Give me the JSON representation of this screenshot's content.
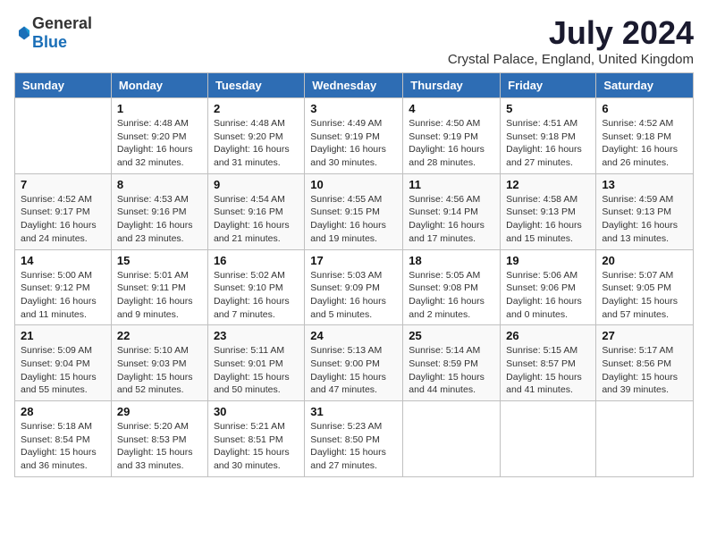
{
  "header": {
    "logo_general": "General",
    "logo_blue": "Blue",
    "month_year": "July 2024",
    "location": "Crystal Palace, England, United Kingdom"
  },
  "weekdays": [
    "Sunday",
    "Monday",
    "Tuesday",
    "Wednesday",
    "Thursday",
    "Friday",
    "Saturday"
  ],
  "weeks": [
    [
      {
        "day": "",
        "info": ""
      },
      {
        "day": "1",
        "info": "Sunrise: 4:48 AM\nSunset: 9:20 PM\nDaylight: 16 hours\nand 32 minutes."
      },
      {
        "day": "2",
        "info": "Sunrise: 4:48 AM\nSunset: 9:20 PM\nDaylight: 16 hours\nand 31 minutes."
      },
      {
        "day": "3",
        "info": "Sunrise: 4:49 AM\nSunset: 9:19 PM\nDaylight: 16 hours\nand 30 minutes."
      },
      {
        "day": "4",
        "info": "Sunrise: 4:50 AM\nSunset: 9:19 PM\nDaylight: 16 hours\nand 28 minutes."
      },
      {
        "day": "5",
        "info": "Sunrise: 4:51 AM\nSunset: 9:18 PM\nDaylight: 16 hours\nand 27 minutes."
      },
      {
        "day": "6",
        "info": "Sunrise: 4:52 AM\nSunset: 9:18 PM\nDaylight: 16 hours\nand 26 minutes."
      }
    ],
    [
      {
        "day": "7",
        "info": "Sunrise: 4:52 AM\nSunset: 9:17 PM\nDaylight: 16 hours\nand 24 minutes."
      },
      {
        "day": "8",
        "info": "Sunrise: 4:53 AM\nSunset: 9:16 PM\nDaylight: 16 hours\nand 23 minutes."
      },
      {
        "day": "9",
        "info": "Sunrise: 4:54 AM\nSunset: 9:16 PM\nDaylight: 16 hours\nand 21 minutes."
      },
      {
        "day": "10",
        "info": "Sunrise: 4:55 AM\nSunset: 9:15 PM\nDaylight: 16 hours\nand 19 minutes."
      },
      {
        "day": "11",
        "info": "Sunrise: 4:56 AM\nSunset: 9:14 PM\nDaylight: 16 hours\nand 17 minutes."
      },
      {
        "day": "12",
        "info": "Sunrise: 4:58 AM\nSunset: 9:13 PM\nDaylight: 16 hours\nand 15 minutes."
      },
      {
        "day": "13",
        "info": "Sunrise: 4:59 AM\nSunset: 9:13 PM\nDaylight: 16 hours\nand 13 minutes."
      }
    ],
    [
      {
        "day": "14",
        "info": "Sunrise: 5:00 AM\nSunset: 9:12 PM\nDaylight: 16 hours\nand 11 minutes."
      },
      {
        "day": "15",
        "info": "Sunrise: 5:01 AM\nSunset: 9:11 PM\nDaylight: 16 hours\nand 9 minutes."
      },
      {
        "day": "16",
        "info": "Sunrise: 5:02 AM\nSunset: 9:10 PM\nDaylight: 16 hours\nand 7 minutes."
      },
      {
        "day": "17",
        "info": "Sunrise: 5:03 AM\nSunset: 9:09 PM\nDaylight: 16 hours\nand 5 minutes."
      },
      {
        "day": "18",
        "info": "Sunrise: 5:05 AM\nSunset: 9:08 PM\nDaylight: 16 hours\nand 2 minutes."
      },
      {
        "day": "19",
        "info": "Sunrise: 5:06 AM\nSunset: 9:06 PM\nDaylight: 16 hours\nand 0 minutes."
      },
      {
        "day": "20",
        "info": "Sunrise: 5:07 AM\nSunset: 9:05 PM\nDaylight: 15 hours\nand 57 minutes."
      }
    ],
    [
      {
        "day": "21",
        "info": "Sunrise: 5:09 AM\nSunset: 9:04 PM\nDaylight: 15 hours\nand 55 minutes."
      },
      {
        "day": "22",
        "info": "Sunrise: 5:10 AM\nSunset: 9:03 PM\nDaylight: 15 hours\nand 52 minutes."
      },
      {
        "day": "23",
        "info": "Sunrise: 5:11 AM\nSunset: 9:01 PM\nDaylight: 15 hours\nand 50 minutes."
      },
      {
        "day": "24",
        "info": "Sunrise: 5:13 AM\nSunset: 9:00 PM\nDaylight: 15 hours\nand 47 minutes."
      },
      {
        "day": "25",
        "info": "Sunrise: 5:14 AM\nSunset: 8:59 PM\nDaylight: 15 hours\nand 44 minutes."
      },
      {
        "day": "26",
        "info": "Sunrise: 5:15 AM\nSunset: 8:57 PM\nDaylight: 15 hours\nand 41 minutes."
      },
      {
        "day": "27",
        "info": "Sunrise: 5:17 AM\nSunset: 8:56 PM\nDaylight: 15 hours\nand 39 minutes."
      }
    ],
    [
      {
        "day": "28",
        "info": "Sunrise: 5:18 AM\nSunset: 8:54 PM\nDaylight: 15 hours\nand 36 minutes."
      },
      {
        "day": "29",
        "info": "Sunrise: 5:20 AM\nSunset: 8:53 PM\nDaylight: 15 hours\nand 33 minutes."
      },
      {
        "day": "30",
        "info": "Sunrise: 5:21 AM\nSunset: 8:51 PM\nDaylight: 15 hours\nand 30 minutes."
      },
      {
        "day": "31",
        "info": "Sunrise: 5:23 AM\nSunset: 8:50 PM\nDaylight: 15 hours\nand 27 minutes."
      },
      {
        "day": "",
        "info": ""
      },
      {
        "day": "",
        "info": ""
      },
      {
        "day": "",
        "info": ""
      }
    ]
  ]
}
